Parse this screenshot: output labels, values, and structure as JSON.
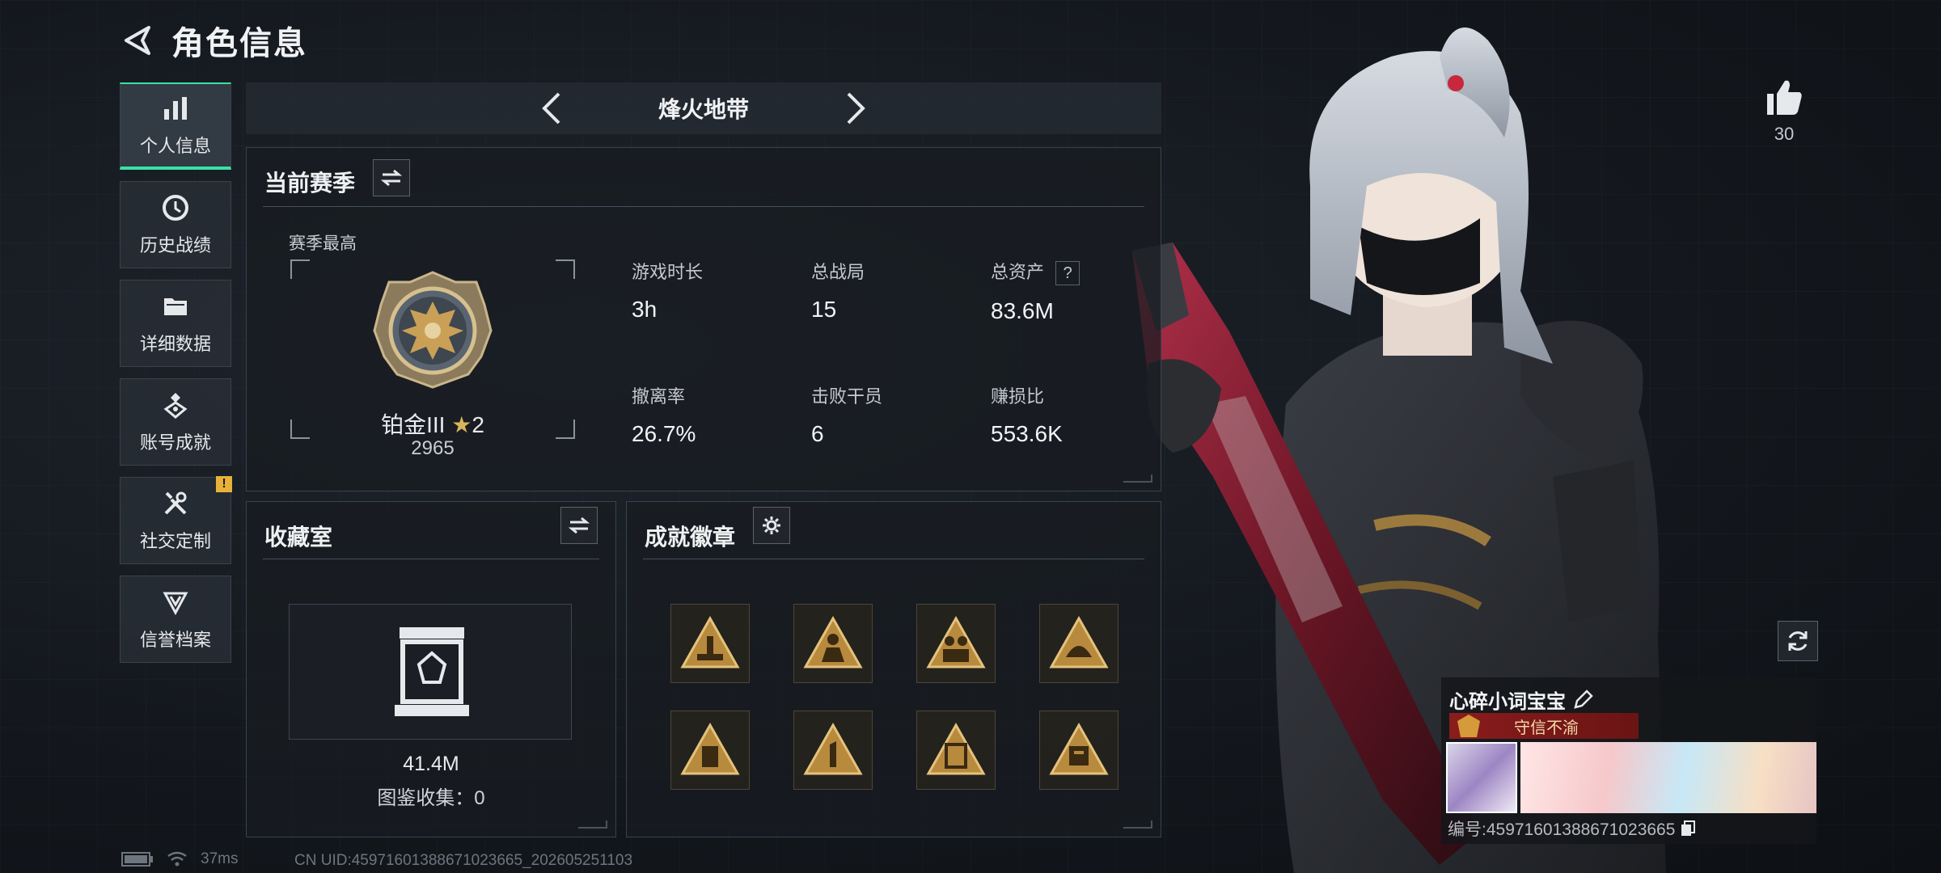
{
  "header": {
    "title": "角色信息"
  },
  "sidebar": {
    "items": [
      {
        "label": "个人信息",
        "icon": "bar-chart-icon",
        "active": true
      },
      {
        "label": "历史战绩",
        "icon": "clock-icon",
        "active": false
      },
      {
        "label": "详细数据",
        "icon": "folder-icon",
        "active": false
      },
      {
        "label": "账号成就",
        "icon": "medal-icon",
        "active": false
      },
      {
        "label": "社交定制",
        "icon": "tools-icon",
        "active": false,
        "badge": "!"
      },
      {
        "label": "信誉档案",
        "icon": "shield-icon",
        "active": false
      }
    ]
  },
  "mode": {
    "title": "烽火地带"
  },
  "season": {
    "title": "当前赛季",
    "best_label": "赛季最高",
    "rank_name": "铂金III",
    "rank_stars": "2",
    "rank_score": "2965",
    "stats": [
      {
        "label": "游戏时长",
        "value": "3h"
      },
      {
        "label": "总战局",
        "value": "15"
      },
      {
        "label": "总资产",
        "value": "83.6M",
        "help": "?"
      },
      {
        "label": "撤离率",
        "value": "26.7%"
      },
      {
        "label": "击败干员",
        "value": "6"
      },
      {
        "label": "赚损比",
        "value": "553.6K"
      }
    ]
  },
  "collection": {
    "title": "收藏室",
    "value": "41.4M",
    "count_text": "图鉴收集：0"
  },
  "achievements": {
    "title": "成就徽章",
    "badge_count": 8
  },
  "likes": {
    "count": "30"
  },
  "profile_card": {
    "name": "心碎小词宝宝",
    "title": "守信不渝",
    "id_text": "编号:459716013886710236​65"
  },
  "footer": {
    "ping": "37ms",
    "uid_line": "CN UID:459716013886710236​65_202605251103"
  },
  "colors": {
    "accent": "#3ce0a6",
    "alert": "#e8b238",
    "gold": "#c9a055",
    "title_red": "#8a1c1c"
  }
}
